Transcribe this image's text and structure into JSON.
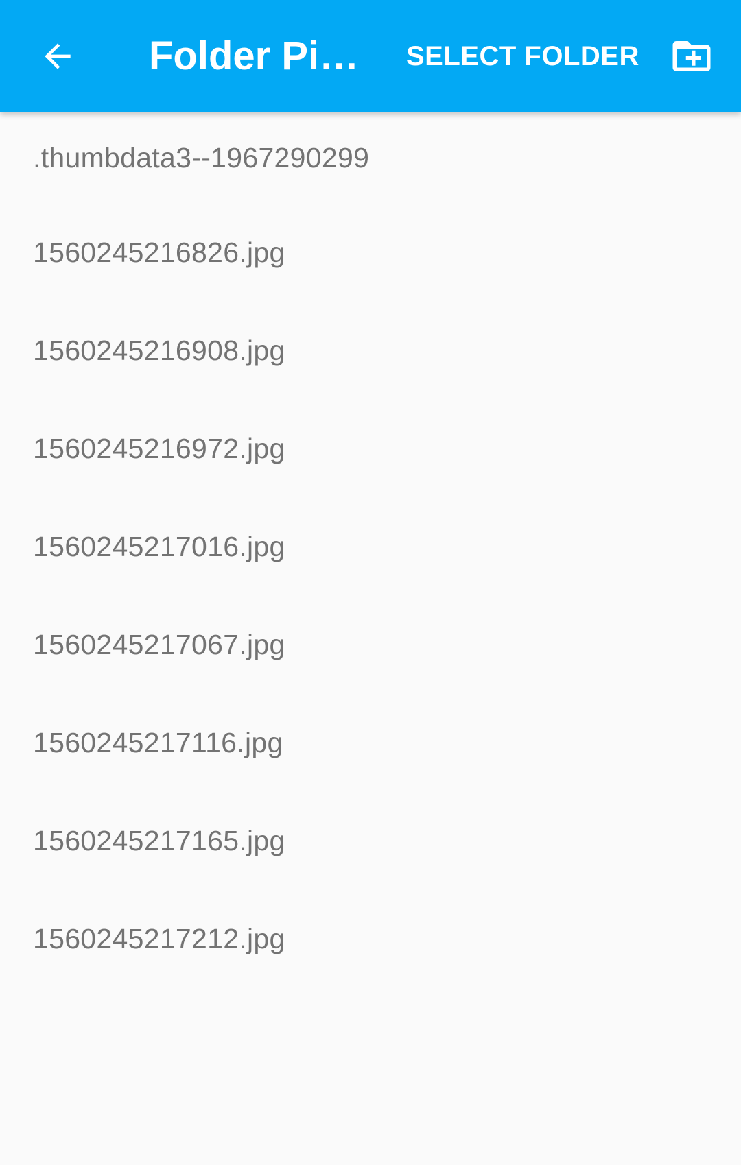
{
  "app_bar": {
    "back_icon": "arrow-left-icon",
    "title": "Folder Pi…",
    "select_folder_label": "SELECT FOLDER",
    "new_folder_icon": "folder-plus-icon",
    "background_color": "#03a9f4",
    "text_color": "#ffffff"
  },
  "files": [
    {
      "name": ".thumbdata3--1967290299"
    },
    {
      "name": "1560245216826.jpg"
    },
    {
      "name": "1560245216908.jpg"
    },
    {
      "name": "1560245216972.jpg"
    },
    {
      "name": "1560245217016.jpg"
    },
    {
      "name": "1560245217067.jpg"
    },
    {
      "name": "1560245217116.jpg"
    },
    {
      "name": "1560245217165.jpg"
    },
    {
      "name": "1560245217212.jpg"
    }
  ]
}
